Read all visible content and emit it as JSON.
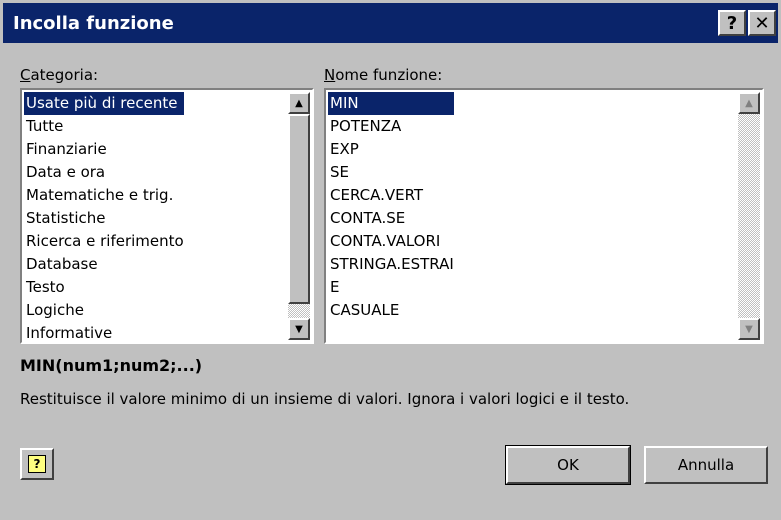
{
  "window": {
    "title": "Incolla funzione",
    "help_glyph": "?",
    "close_glyph": "✕"
  },
  "category": {
    "label_accel": "C",
    "label_rest": "ategoria:",
    "items": [
      "Usate più di recente",
      "Tutte",
      "Finanziarie",
      "Data e ora",
      "Matematiche e trig.",
      "Statistiche",
      "Ricerca e riferimento",
      "Database",
      "Testo",
      "Logiche",
      "Informative"
    ],
    "selected": "Usate più di recente"
  },
  "functions": {
    "label_accel": "N",
    "label_rest": "ome funzione:",
    "items": [
      "MIN",
      "POTENZA",
      "EXP",
      "SE",
      "CERCA.VERT",
      "CONTA.SE",
      "CONTA.VALORI",
      "STRINGA.ESTRAI",
      "E",
      "CASUALE"
    ],
    "selected": "MIN"
  },
  "syntax": "MIN(num1;num2;...)",
  "description": "Restituisce il valore minimo di un insieme di valori. Ignora i valori logici e il testo.",
  "buttons": {
    "ok": "OK",
    "cancel": "Annulla",
    "help_glyph": "?"
  },
  "colors": {
    "titlebar": "#0a246a",
    "selection": "#0a246a",
    "face": "#c0c0c0"
  }
}
